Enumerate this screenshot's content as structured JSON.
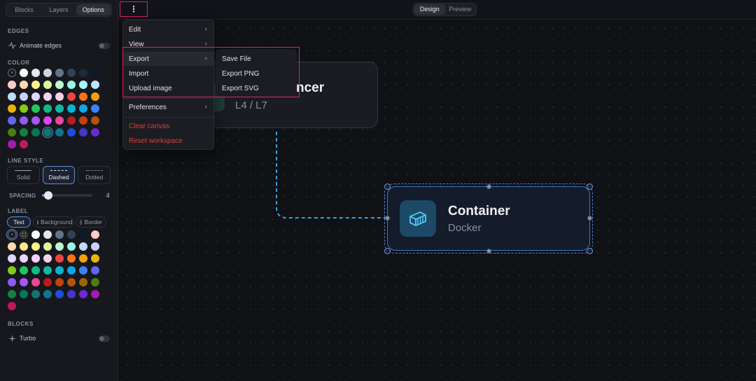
{
  "sidebar": {
    "tabs": [
      "Blocks",
      "Layers",
      "Options"
    ],
    "active_tab": "Options",
    "edges": {
      "title": "EDGES",
      "animate_label": "Animate edges",
      "animate_on": false
    },
    "color": {
      "title": "COLOR",
      "none_symbol": "×",
      "swatches": [
        "#ffffff",
        "#e5e7eb",
        "#cbd5e1",
        "#64748b",
        "#334155",
        "#1e293b",
        "#0f172a",
        "#fecaca",
        "#fed7aa",
        "#fef08a",
        "#d9f99d",
        "#bbf7d0",
        "#99f6e4",
        "#a5f3fc",
        "#bae6fd",
        "#bfdbfe",
        "#c7d2fe",
        "#ddd6fe",
        "#f5d0fe",
        "#fbcfe8",
        "#ef4444",
        "#f97316",
        "#f59e0b",
        "#eab308",
        "#84cc16",
        "#22c55e",
        "#10b981",
        "#14b8a6",
        "#06b6d4",
        "#0ea5e9",
        "#3b82f6",
        "#6366f1",
        "#8b5cf6",
        "#a855f7",
        "#d946ef",
        "#ec4899",
        "#b91c1c",
        "#c2410c",
        "#b45309",
        "#4d7c0f",
        "#15803d",
        "#047857",
        "#0f766e",
        "#0e7490",
        "#1d4ed8",
        "#4338ca",
        "#6d28d9",
        "#a21caf",
        "#be185d"
      ],
      "selected_index": 42
    },
    "line_style": {
      "title": "LINE STYLE",
      "options": [
        "Solid",
        "Dashed",
        "Dotted"
      ],
      "active": "Dashed"
    },
    "spacing": {
      "title": "SPACING",
      "value": "4",
      "fraction": 0.08
    },
    "label": {
      "title": "LABEL",
      "options": [
        "Text",
        "Background",
        "Border"
      ],
      "active": "Text",
      "swatches": [
        "#ffffff",
        "#e5e7eb",
        "#64748b",
        "#334155",
        "#0f172a",
        "#fecaca",
        "#fed7aa",
        "#fde68a",
        "#fef08a",
        "#d9f99d",
        "#bbf7d0",
        "#99f6e4",
        "#bfdbfe",
        "#c7d2fe",
        "#ddd6fe",
        "#e9d5ff",
        "#f5d0fe",
        "#fbcfe8",
        "#ef4444",
        "#f97316",
        "#f59e0b",
        "#eab308",
        "#84cc16",
        "#22c55e",
        "#10b981",
        "#14b8a6",
        "#06b6d4",
        "#0ea5e9",
        "#3b82f6",
        "#6366f1",
        "#8b5cf6",
        "#a855f7",
        "#ec4899",
        "#b91c1c",
        "#c2410c",
        "#b45309",
        "#a16207",
        "#4d7c0f",
        "#15803d",
        "#047857",
        "#0f766e",
        "#0e7490",
        "#1d4ed8",
        "#4338ca",
        "#6d28d9",
        "#a21caf",
        "#be185d"
      ]
    },
    "blocks": {
      "title": "BLOCKS",
      "turbo_label": "Turbo",
      "turbo_on": false
    }
  },
  "topbar": {
    "menu_symbol": "⋮",
    "modes": [
      "Design",
      "Preview"
    ],
    "active_mode": "Design"
  },
  "menu": {
    "items": [
      {
        "label": "Edit",
        "submenu": true
      },
      {
        "label": "View",
        "submenu": true
      },
      {
        "label": "Export",
        "submenu": true
      },
      {
        "label": "Import",
        "submenu": false
      },
      {
        "label": "Upload image",
        "submenu": false
      },
      {
        "label": "Preferences",
        "submenu": true
      },
      {
        "label": "Clear canvas",
        "submenu": false,
        "danger": true
      },
      {
        "label": "Reset workspace",
        "submenu": false,
        "danger": true
      }
    ],
    "chevron": "›",
    "export_submenu": [
      "Save File",
      "Export PNG",
      "Export SVG"
    ]
  },
  "canvas": {
    "node_lb": {
      "title": "ncer",
      "subtitle": "L4 / L7"
    },
    "node_container": {
      "title": "Container",
      "subtitle": "Docker"
    }
  },
  "colors": {
    "accent": "#3f74c9",
    "highlight": "#e0245e",
    "edge": "#3aa0d8",
    "danger": "#d0443f"
  }
}
